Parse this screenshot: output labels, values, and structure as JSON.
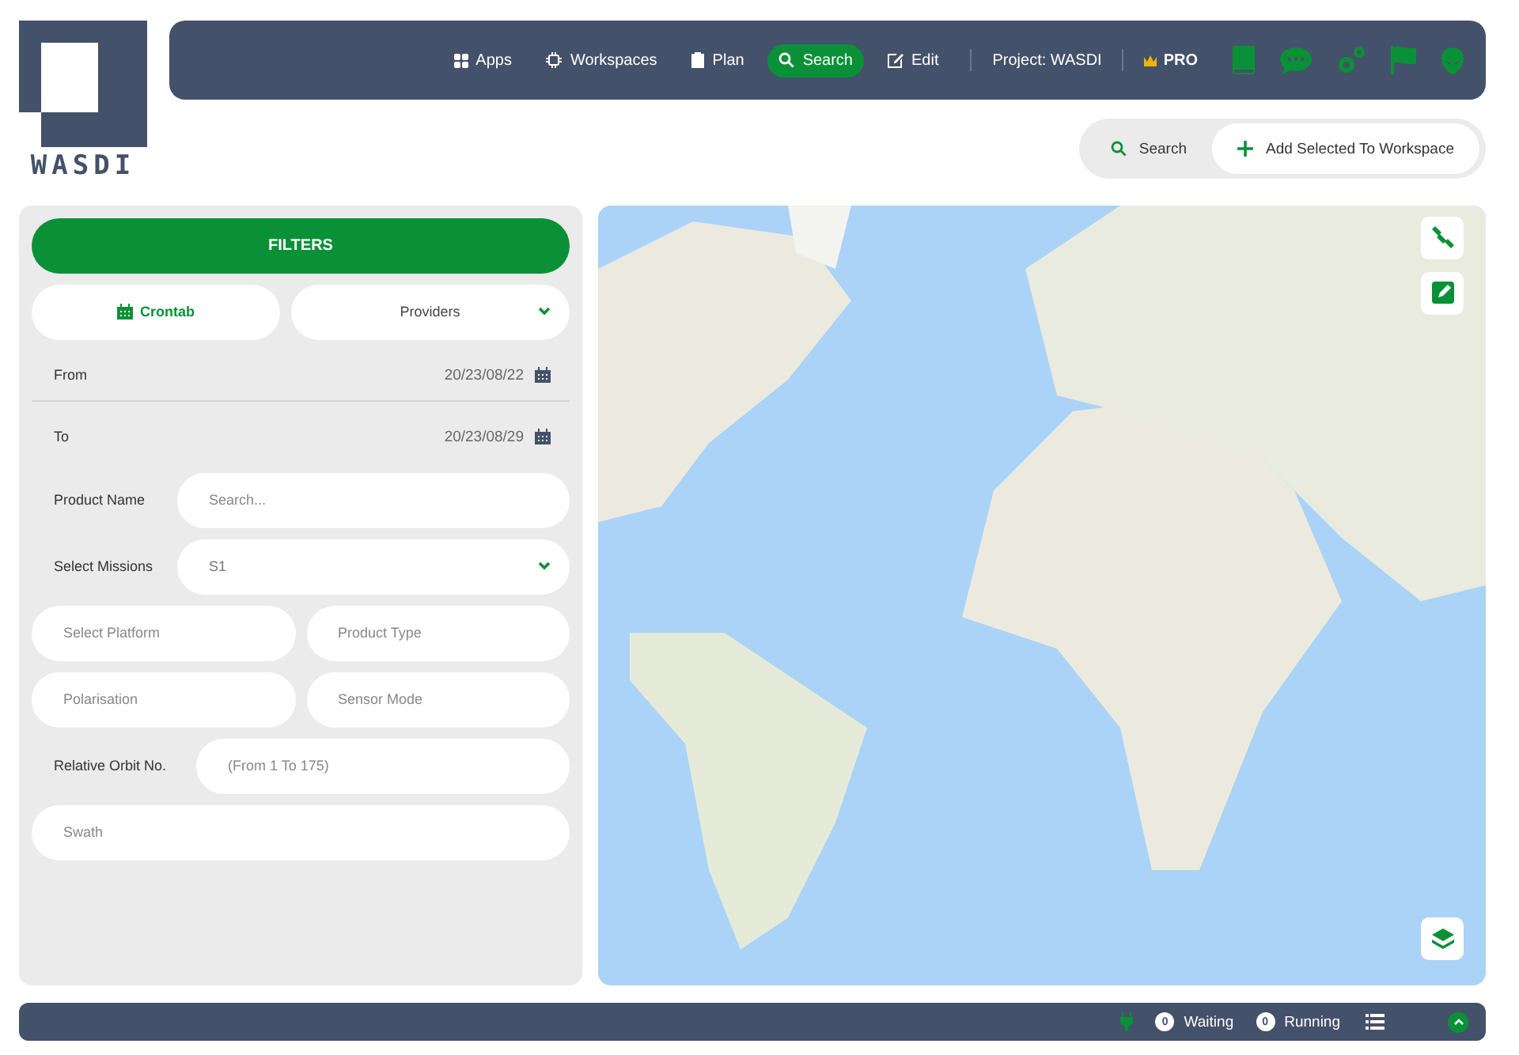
{
  "logo": {
    "text": "WASDI"
  },
  "nav": {
    "items": [
      {
        "label": "Apps",
        "selected": false
      },
      {
        "label": "Workspaces",
        "selected": false
      },
      {
        "label": "Plan",
        "selected": false
      },
      {
        "label": "Search",
        "selected": true
      },
      {
        "label": "Edit",
        "selected": false
      }
    ],
    "project": "Project: WASDI",
    "plan_badge": "PRO"
  },
  "actions": [
    {
      "label": "Search",
      "selected": false
    },
    {
      "label": "Add Selected To Workspace",
      "selected": true
    }
  ],
  "filters": {
    "title": "FILTERS",
    "crontab": "Crontab",
    "providers": "Providers",
    "from": {
      "label": "From",
      "value": "20/23/08/22"
    },
    "to": {
      "label": "To",
      "value": "20/23/08/29"
    },
    "product_name": {
      "label": "Product Name",
      "placeholder": "Search..."
    },
    "missions": {
      "label": "Select Missions",
      "value": "S1"
    },
    "platform": {
      "placeholder": "Select Platform"
    },
    "product_type": {
      "placeholder": "Product Type"
    },
    "polarisation": {
      "placeholder": "Polarisation"
    },
    "sensor_mode": {
      "placeholder": "Sensor Mode"
    },
    "relative_orbit": {
      "label": "Relative Orbit No.",
      "placeholder": "(From 1 To 175)"
    },
    "swath": {
      "placeholder": "Swath"
    }
  },
  "status_bar": {
    "waiting_count": "0",
    "waiting": "Waiting",
    "running_count": "0",
    "running": "Running"
  }
}
